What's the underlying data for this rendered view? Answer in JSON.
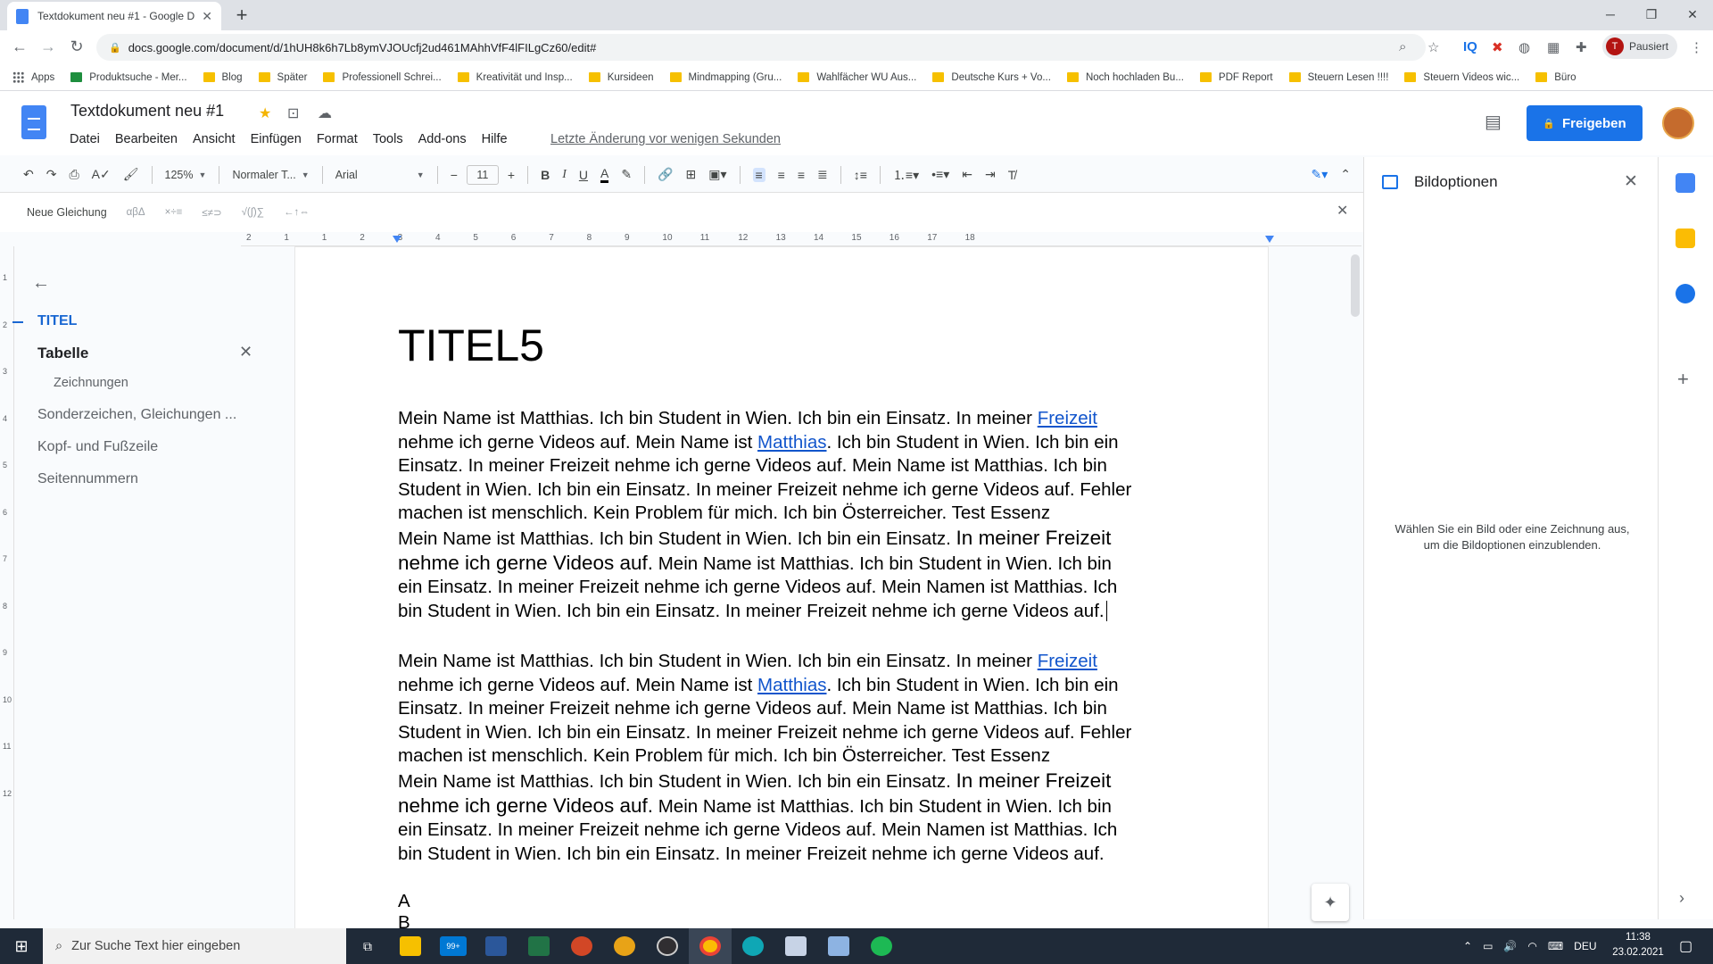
{
  "browser": {
    "tab_title": "Textdokument neu #1 - Google D",
    "url": "docs.google.com/document/d/1hUH8k6h7Lb8ymVJOUcfj2ud461MAhhVfF4lFILgCz60/edit#",
    "profile_label": "Pausiert",
    "profile_initial": "T",
    "bookmarks": [
      {
        "label": "Apps",
        "kind": "grid"
      },
      {
        "label": "Produktsuche - Mer...",
        "kind": "site"
      },
      {
        "label": "Blog",
        "kind": "folder"
      },
      {
        "label": "Später",
        "kind": "folder"
      },
      {
        "label": "Professionell Schrei...",
        "kind": "folder"
      },
      {
        "label": "Kreativität und Insp...",
        "kind": "folder"
      },
      {
        "label": "Kursideen",
        "kind": "folder"
      },
      {
        "label": "Mindmapping (Gru...",
        "kind": "folder"
      },
      {
        "label": "Wahlfächer WU Aus...",
        "kind": "folder"
      },
      {
        "label": "Deutsche Kurs + Vo...",
        "kind": "folder"
      },
      {
        "label": "Noch hochladen Bu...",
        "kind": "folder"
      },
      {
        "label": "PDF Report",
        "kind": "folder"
      },
      {
        "label": "Steuern Lesen !!!!",
        "kind": "folder"
      },
      {
        "label": "Steuern Videos wic...",
        "kind": "folder"
      },
      {
        "label": "Büro",
        "kind": "folder"
      }
    ]
  },
  "docs": {
    "title": "Textdokument neu #1",
    "menu": [
      "Datei",
      "Bearbeiten",
      "Ansicht",
      "Einfügen",
      "Format",
      "Tools",
      "Add-ons",
      "Hilfe"
    ],
    "last_edit": "Letzte Änderung vor wenigen Sekunden",
    "share_label": "Freigeben",
    "toolbar": {
      "zoom": "125%",
      "style": "Normaler T...",
      "font": "Arial",
      "font_size": "11"
    },
    "equation_bar": {
      "new_equation": "Neue Gleichung",
      "groups": [
        "αβΔ",
        "×÷≡",
        "≤≠⊃",
        "√(∫)∑",
        "←↑⇔"
      ]
    },
    "ruler_numbers": [
      "2",
      "1",
      "1",
      "2",
      "3",
      "4",
      "5",
      "6",
      "7",
      "8",
      "9",
      "10",
      "11",
      "12",
      "13",
      "14",
      "15",
      "16",
      "17",
      "18"
    ],
    "left_ruler_numbers": [
      "1",
      "2",
      "3",
      "4",
      "5",
      "6",
      "7",
      "8",
      "9",
      "10",
      "11",
      "12"
    ],
    "outline": {
      "items": [
        {
          "label": "TITEL"
        },
        {
          "label": "Tabelle"
        },
        {
          "label": "Zeichnungen"
        },
        {
          "label": "Sonderzeichen, Gleichungen ..."
        },
        {
          "label": "Kopf- und Fußzeile"
        },
        {
          "label": "Seitennummern"
        }
      ]
    },
    "document": {
      "heading": "TITEL5",
      "para1": {
        "a": "Mein Name ist Matthias. Ich bin Student in Wien. Ich bin ein Einsatz. In meiner ",
        "link1": "Freizeit",
        "b": " nehme ich gerne Videos auf. Mein Name ist ",
        "link2": "Matthias",
        "c": ". Ich bin Student in Wien. Ich bin ein Einsatz. In meiner Freizeit nehme ich gerne Videos auf. Mein Name ist Matthias. Ich bin Student in Wien. Ich bin ein Einsatz. In meiner Freizeit nehme ich gerne Videos auf. Fehler machen ist menschlich. Kein Problem für mich. Ich bin Österreicher. Test Essenz"
      },
      "para2": {
        "a": "Mein Name ist Matthias. Ich bin Student in Wien. Ich bin ein Einsatz. ",
        "big": "In meiner Freizeit nehme ich gerne Videos auf.",
        "b": " Mein Name ist Matthias. Ich bin Student in Wien. Ich bin ein Einsatz. In meiner Freizeit nehme ich gerne Videos auf. Mein Namen ist Matthias. Ich bin Student in Wien. Ich bin ein Einsatz. In meiner Freizeit nehme ich gerne Videos auf."
      },
      "line_a": "A",
      "line_b": "B"
    },
    "side_panel": {
      "title": "Bildoptionen",
      "message": "Wählen Sie ein Bild oder eine Zeichnung aus, um die Bildoptionen einzublenden."
    }
  },
  "taskbar": {
    "search_placeholder": "Zur Suche Text hier eingeben",
    "mail_badge": "99+",
    "language": "DEU",
    "time": "11:38",
    "date": "23.02.2021"
  },
  "colors": {
    "accent": "#1a73e8",
    "link": "#1155cc",
    "outline_active": "#1967d2"
  }
}
